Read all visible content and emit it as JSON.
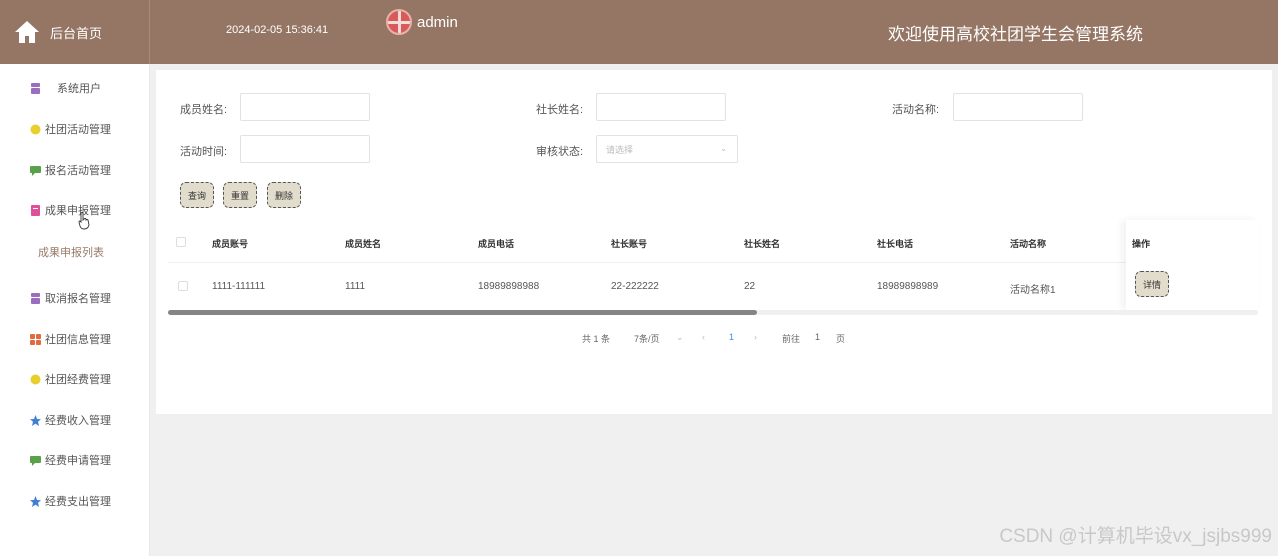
{
  "header": {
    "home_label": "后台首页",
    "datetime": "2024-02-05 15:36:41",
    "username": "admin",
    "system_title": "欢迎使用高校社团学生会管理系统",
    "bg_color": "#957665"
  },
  "sidebar": {
    "items": [
      {
        "label": "系统用户",
        "icon": "user-icon",
        "color": "#9b6dc1"
      },
      {
        "label": "社团活动管理",
        "icon": "smile-icon",
        "color": "#e9cf2b"
      },
      {
        "label": "报名活动管理",
        "icon": "chat-icon",
        "color": "#5aa14b"
      },
      {
        "label": "成果申报管理",
        "icon": "document-icon",
        "color": "#e0509a"
      },
      {
        "label": "取消报名管理",
        "icon": "user-icon",
        "color": "#9b6dc1"
      },
      {
        "label": "社团信息管理",
        "icon": "grid-icon",
        "color": "#e06b3f"
      },
      {
        "label": "社团经费管理",
        "icon": "smile-icon",
        "color": "#e9cf2b"
      },
      {
        "label": "经费收入管理",
        "icon": "star-icon",
        "color": "#3f7fd6"
      },
      {
        "label": "经费申请管理",
        "icon": "chat-icon",
        "color": "#5aa14b"
      },
      {
        "label": "经费支出管理",
        "icon": "star-icon",
        "color": "#3f7fd6"
      }
    ],
    "submenu_label": "成果申报列表"
  },
  "search": {
    "member_name_label": "成员姓名:",
    "president_name_label": "社长姓名:",
    "activity_name_label": "活动名称:",
    "activity_time_label": "活动时间:",
    "review_status_label": "审核状态:",
    "review_status_placeholder": "请选择",
    "query_button": "查询",
    "reset_button": "重置",
    "delete_button": "删除"
  },
  "table": {
    "columns": [
      "成员账号",
      "成员姓名",
      "成员电话",
      "社长账号",
      "社长姓名",
      "社长电话",
      "活动名称",
      "操作"
    ],
    "rows": [
      {
        "member_account": "1111-111111",
        "member_name": "1111",
        "member_phone": "18989898988",
        "president_account": "22-222222",
        "president_name": "22",
        "president_phone": "18989898989",
        "activity_name": "活动名称1",
        "action": "详情"
      }
    ],
    "horizontal_scroll_fraction": 0.54
  },
  "pagination": {
    "total": "共 1 条",
    "page_size": "7条/页",
    "current_page": "1",
    "goto_label": "前往",
    "goto_value": "1",
    "page_suffix": "页"
  },
  "watermark": "CSDN @计算机毕设vx_jsjbs999"
}
